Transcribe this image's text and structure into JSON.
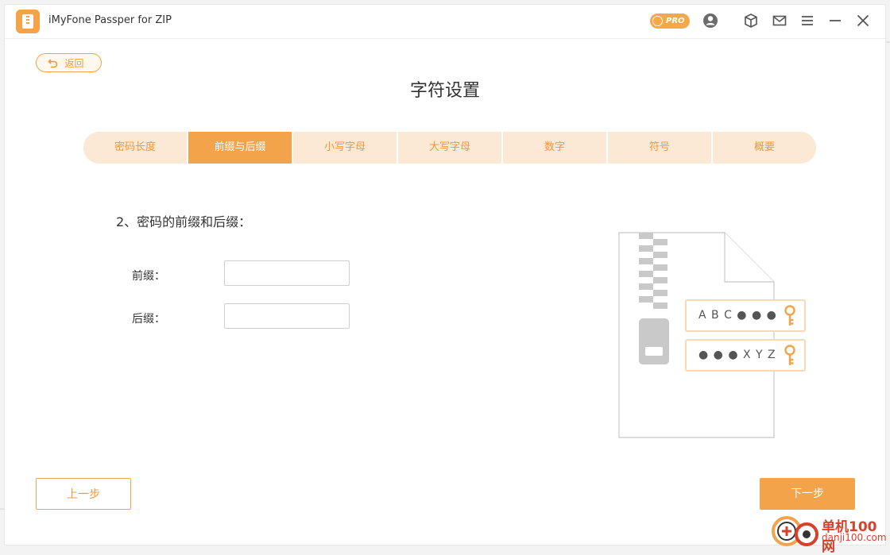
{
  "app": {
    "title": "iMyFone Passper for ZIP",
    "pro_label": "PRO"
  },
  "titlebar_icons": [
    "pro-badge",
    "account-icon",
    "box-icon",
    "mail-icon",
    "menu-icon",
    "minimize-icon",
    "close-icon"
  ],
  "back_label": "返回",
  "page_title": "字符设置",
  "tabs": [
    {
      "label": "密码长度"
    },
    {
      "label": "前缀与后缀"
    },
    {
      "label": "小写字母"
    },
    {
      "label": "大写字母"
    },
    {
      "label": "数字"
    },
    {
      "label": "符号"
    },
    {
      "label": "概要"
    }
  ],
  "active_tab": 1,
  "section_title": "2、密码的前缀和后缀：",
  "fields": {
    "prefix": {
      "label": "前缀：",
      "value": ""
    },
    "suffix": {
      "label": "后缀：",
      "value": ""
    }
  },
  "illustration": {
    "card1": "A B C ● ● ●",
    "card2": "● ● ● X Y Z"
  },
  "buttons": {
    "prev": "上一步",
    "next": "下一步"
  },
  "watermark": {
    "name": "单机100网",
    "url": "danji100.com"
  },
  "colors": {
    "accent": "#f3a44a",
    "tab_bg": "#fbe8d5",
    "watermark": "#d9402c"
  }
}
